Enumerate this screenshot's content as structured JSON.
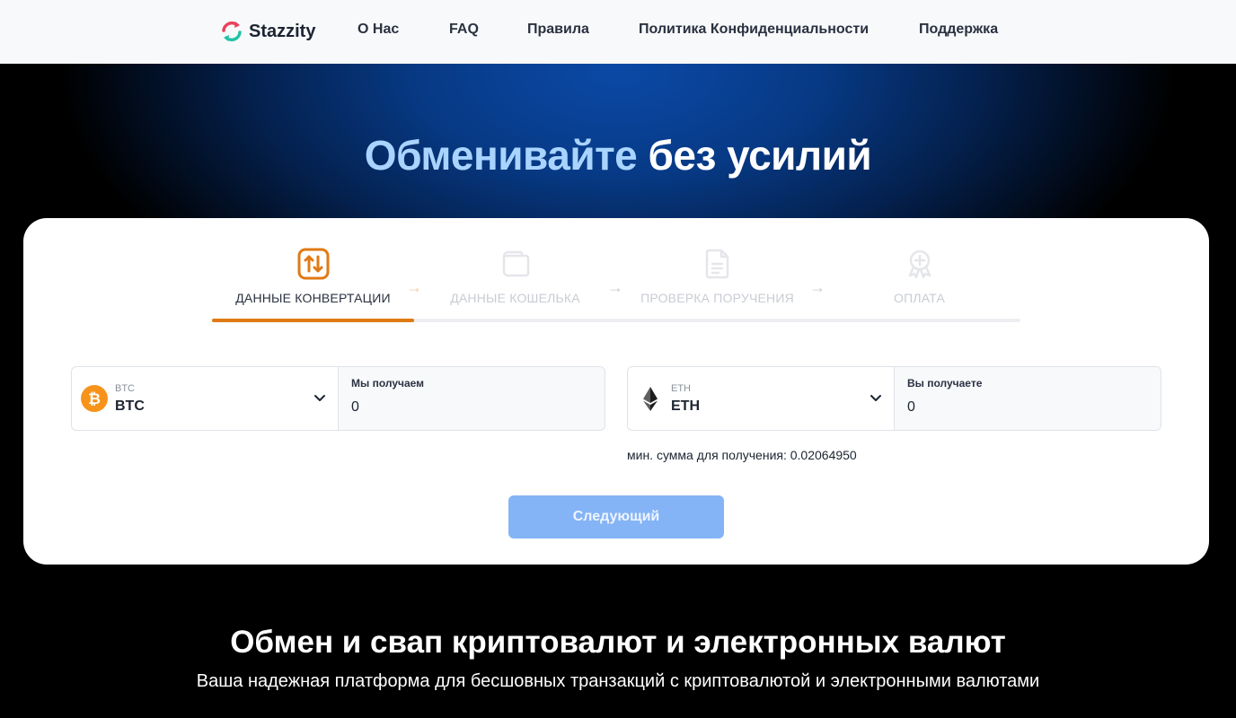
{
  "nav": {
    "brand": "Stazzity",
    "links": [
      "О Нас",
      "FAQ",
      "Правила",
      "Политика Конфиденциальности",
      "Поддержка"
    ]
  },
  "hero": {
    "title_accent": "Обменивайте",
    "title_main": "без усилий"
  },
  "steps": [
    {
      "label": "ДАННЫЕ КОНВЕРТАЦИИ",
      "icon": "swap-arrows-icon",
      "active": true
    },
    {
      "label": "ДАННЫЕ КОШЕЛЬКА",
      "icon": "wallet-icon",
      "active": false
    },
    {
      "label": "ПРОВЕРКА ПОРУЧЕНИЯ",
      "icon": "document-icon",
      "active": false
    },
    {
      "label": "ОПЛАТА",
      "icon": "badge-icon",
      "active": false
    }
  ],
  "exchange": {
    "send": {
      "currency_small": "BTC",
      "currency": "BTC",
      "amount_label": "Мы получаем",
      "amount": "0",
      "icon": "bitcoin-icon"
    },
    "receive": {
      "currency_small": "ETH",
      "currency": "ETH",
      "amount_label": "Вы получаете",
      "amount": "0",
      "icon": "ethereum-icon"
    },
    "min_sum": "мин. сумма для получения: 0.02064950"
  },
  "next_button": "Следующий",
  "section": {
    "title": "Обмен и свап криптовалют и электронных валют",
    "subtitle": "Ваша надежная платформа для бесшовных транзакций с криптовалютой и электронными валютами"
  },
  "colors": {
    "accent": "#e07a14",
    "button": "#84b4f5",
    "title_accent": "#a9d4ff"
  }
}
